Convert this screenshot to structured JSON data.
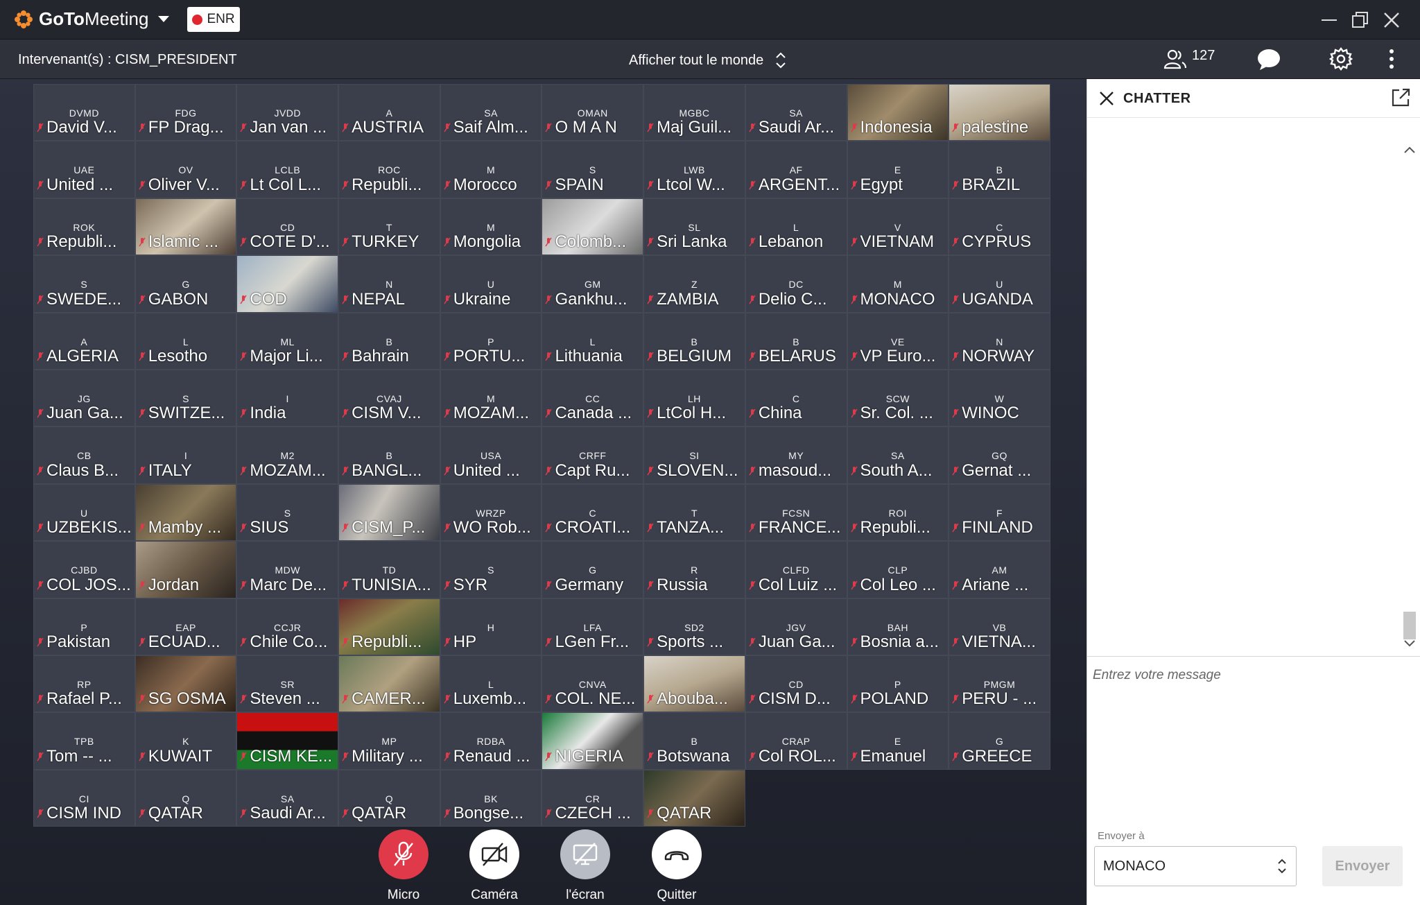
{
  "app": {
    "brand_bold": "GoTo",
    "brand_rest": "Meeting",
    "recording_label": "ENR"
  },
  "subbar": {
    "presenter": "Intervenant(s) : CISM_PRESIDENT",
    "view_mode": "Afficher tout le monde",
    "participant_count": "127"
  },
  "tiles": [
    {
      "initials": "DVMD",
      "name": "David V...",
      "video": ""
    },
    {
      "initials": "FDG",
      "name": "FP Drag...",
      "video": ""
    },
    {
      "initials": "JVDD",
      "name": "Jan van ...",
      "video": ""
    },
    {
      "initials": "A",
      "name": "AUSTRIA",
      "video": ""
    },
    {
      "initials": "SA",
      "name": "Saif Alm...",
      "video": ""
    },
    {
      "initials": "OMAN",
      "name": "O M A N",
      "video": ""
    },
    {
      "initials": "MGBC",
      "name": "Maj Guil...",
      "video": ""
    },
    {
      "initials": "SA",
      "name": "Saudi Ar...",
      "video": ""
    },
    {
      "initials": "",
      "name": "Indonesia",
      "video": "v1"
    },
    {
      "initials": "",
      "name": "palestine",
      "video": "v2"
    },
    {
      "initials": "UAE",
      "name": "United ...",
      "video": ""
    },
    {
      "initials": "OV",
      "name": "Oliver V...",
      "video": ""
    },
    {
      "initials": "LCLB",
      "name": "Lt Col L...",
      "video": ""
    },
    {
      "initials": "ROC",
      "name": "Republi...",
      "video": ""
    },
    {
      "initials": "M",
      "name": "Morocco",
      "video": ""
    },
    {
      "initials": "S",
      "name": "SPAIN",
      "video": ""
    },
    {
      "initials": "LWB",
      "name": "Ltcol W...",
      "video": ""
    },
    {
      "initials": "AF",
      "name": "ARGENT...",
      "video": ""
    },
    {
      "initials": "E",
      "name": "Egypt",
      "video": ""
    },
    {
      "initials": "B",
      "name": "BRAZIL",
      "video": ""
    },
    {
      "initials": "ROK",
      "name": "Republi...",
      "video": ""
    },
    {
      "initials": "",
      "name": "Islamic ...",
      "video": "v4"
    },
    {
      "initials": "CD",
      "name": "COTE D'...",
      "video": ""
    },
    {
      "initials": "T",
      "name": "TURKEY",
      "video": ""
    },
    {
      "initials": "M",
      "name": "Mongolia",
      "video": ""
    },
    {
      "initials": "",
      "name": "Colomb...",
      "video": "v6"
    },
    {
      "initials": "SL",
      "name": "Sri Lanka",
      "video": ""
    },
    {
      "initials": "L",
      "name": "Lebanon",
      "video": ""
    },
    {
      "initials": "V",
      "name": "VIETNAM",
      "video": ""
    },
    {
      "initials": "C",
      "name": "CYPRUS",
      "video": ""
    },
    {
      "initials": "S",
      "name": "SWEDE...",
      "video": ""
    },
    {
      "initials": "G",
      "name": "GABON",
      "video": ""
    },
    {
      "initials": "",
      "name": "COD",
      "video": "v5"
    },
    {
      "initials": "N",
      "name": "NEPAL",
      "video": ""
    },
    {
      "initials": "U",
      "name": "Ukraine",
      "video": ""
    },
    {
      "initials": "GM",
      "name": "Gankhu...",
      "video": ""
    },
    {
      "initials": "Z",
      "name": "ZAMBIA",
      "video": ""
    },
    {
      "initials": "DC",
      "name": "Delio C...",
      "video": ""
    },
    {
      "initials": "M",
      "name": "MONACO",
      "video": ""
    },
    {
      "initials": "U",
      "name": "UGANDA",
      "video": ""
    },
    {
      "initials": "A",
      "name": "ALGERIA",
      "video": ""
    },
    {
      "initials": "L",
      "name": "Lesotho",
      "video": ""
    },
    {
      "initials": "ML",
      "name": "Major Li...",
      "video": ""
    },
    {
      "initials": "B",
      "name": "Bahrain",
      "video": ""
    },
    {
      "initials": "P",
      "name": "PORTU...",
      "video": ""
    },
    {
      "initials": "L",
      "name": "Lithuania",
      "video": ""
    },
    {
      "initials": "B",
      "name": "BELGIUM",
      "video": ""
    },
    {
      "initials": "B",
      "name": "BELARUS",
      "video": ""
    },
    {
      "initials": "VE",
      "name": "VP Euro...",
      "video": ""
    },
    {
      "initials": "N",
      "name": "NORWAY",
      "video": ""
    },
    {
      "initials": "JG",
      "name": "Juan Ga...",
      "video": ""
    },
    {
      "initials": "S",
      "name": "SWITZE...",
      "video": ""
    },
    {
      "initials": "I",
      "name": "India",
      "video": ""
    },
    {
      "initials": "CVAJ",
      "name": "CISM V...",
      "video": ""
    },
    {
      "initials": "M",
      "name": "MOZAM...",
      "video": ""
    },
    {
      "initials": "CC",
      "name": "Canada ...",
      "video": ""
    },
    {
      "initials": "LH",
      "name": "LtCol H...",
      "video": ""
    },
    {
      "initials": "C",
      "name": "China",
      "video": ""
    },
    {
      "initials": "SCW",
      "name": "Sr. Col. ...",
      "video": ""
    },
    {
      "initials": "W",
      "name": "WINOC",
      "video": ""
    },
    {
      "initials": "CB",
      "name": "Claus B...",
      "video": ""
    },
    {
      "initials": "I",
      "name": "ITALY",
      "video": ""
    },
    {
      "initials": "M2",
      "name": "MOZAM...",
      "video": ""
    },
    {
      "initials": "B",
      "name": "BANGL...",
      "video": ""
    },
    {
      "initials": "USA",
      "name": "United ...",
      "video": ""
    },
    {
      "initials": "CRFF",
      "name": "Capt Ru...",
      "video": ""
    },
    {
      "initials": "SI",
      "name": "SLOVEN...",
      "video": ""
    },
    {
      "initials": "MY",
      "name": "masoud...",
      "video": ""
    },
    {
      "initials": "SA",
      "name": "South A...",
      "video": ""
    },
    {
      "initials": "GQ",
      "name": "Gernat ...",
      "video": ""
    },
    {
      "initials": "U",
      "name": "UZBEKIS...",
      "video": ""
    },
    {
      "initials": "",
      "name": "Mamby ...",
      "video": "v12"
    },
    {
      "initials": "S",
      "name": "SIUS",
      "video": ""
    },
    {
      "initials": "",
      "name": "CISM_P...",
      "video": "v3"
    },
    {
      "initials": "WRZP",
      "name": "WO Rob...",
      "video": ""
    },
    {
      "initials": "C",
      "name": "CROATI...",
      "video": ""
    },
    {
      "initials": "T",
      "name": "TANZA...",
      "video": ""
    },
    {
      "initials": "FCSN",
      "name": "FRANCE...",
      "video": ""
    },
    {
      "initials": "ROI",
      "name": "Republi...",
      "video": ""
    },
    {
      "initials": "F",
      "name": "FINLAND",
      "video": ""
    },
    {
      "initials": "CJBD",
      "name": "COL JOS...",
      "video": ""
    },
    {
      "initials": "",
      "name": "Jordan",
      "video": "v9"
    },
    {
      "initials": "MDW",
      "name": "Marc De...",
      "video": ""
    },
    {
      "initials": "TD",
      "name": "TUNISIA...",
      "video": ""
    },
    {
      "initials": "S",
      "name": "SYR",
      "video": ""
    },
    {
      "initials": "G",
      "name": "Germany",
      "video": ""
    },
    {
      "initials": "R",
      "name": "Russia",
      "video": ""
    },
    {
      "initials": "CLFD",
      "name": "Col Luiz ...",
      "video": ""
    },
    {
      "initials": "CLP",
      "name": "Col Leo ...",
      "video": ""
    },
    {
      "initials": "AM",
      "name": "Ariane ...",
      "video": ""
    },
    {
      "initials": "P",
      "name": "Pakistan",
      "video": ""
    },
    {
      "initials": "EAP",
      "name": "ECUAD...",
      "video": ""
    },
    {
      "initials": "CCJR",
      "name": "Chile Co...",
      "video": ""
    },
    {
      "initials": "",
      "name": "Republi...",
      "video": "v7"
    },
    {
      "initials": "H",
      "name": "HP",
      "video": ""
    },
    {
      "initials": "LFA",
      "name": "LGen Fr...",
      "video": ""
    },
    {
      "initials": "SD2",
      "name": "Sports ...",
      "video": ""
    },
    {
      "initials": "JGV",
      "name": "Juan Ga...",
      "video": ""
    },
    {
      "initials": "BAH",
      "name": "Bosnia a...",
      "video": ""
    },
    {
      "initials": "VB",
      "name": "VIETNA...",
      "video": ""
    },
    {
      "initials": "RP",
      "name": "Rafael P...",
      "video": ""
    },
    {
      "initials": "",
      "name": "SG OSMA",
      "video": "v8"
    },
    {
      "initials": "SR",
      "name": "Steven ...",
      "video": ""
    },
    {
      "initials": "",
      "name": "CAMER...",
      "video": "v13"
    },
    {
      "initials": "L",
      "name": "Luxemb...",
      "video": ""
    },
    {
      "initials": "CNVA",
      "name": "COL. NE...",
      "video": ""
    },
    {
      "initials": "",
      "name": "Abouba...",
      "video": "v2"
    },
    {
      "initials": "CD",
      "name": "CISM D...",
      "video": ""
    },
    {
      "initials": "P",
      "name": "POLAND",
      "video": ""
    },
    {
      "initials": "PMGM",
      "name": "PERU - ...",
      "video": ""
    },
    {
      "initials": "TPB",
      "name": "Tom -- ...",
      "video": ""
    },
    {
      "initials": "K",
      "name": "KUWAIT",
      "video": ""
    },
    {
      "initials": "",
      "name": "CISM KE...",
      "video": "v10"
    },
    {
      "initials": "MP",
      "name": "Military ...",
      "video": ""
    },
    {
      "initials": "RDBA",
      "name": "Renaud ...",
      "video": ""
    },
    {
      "initials": "",
      "name": "NIGERIA",
      "video": "v11"
    },
    {
      "initials": "B",
      "name": "Botswana",
      "video": ""
    },
    {
      "initials": "CRAP",
      "name": "Col ROL...",
      "video": ""
    },
    {
      "initials": "E",
      "name": "Emanuel",
      "video": ""
    },
    {
      "initials": "G",
      "name": "GREECE",
      "video": ""
    },
    {
      "initials": "CI",
      "name": "CISM IND",
      "video": ""
    },
    {
      "initials": "Q",
      "name": "QATAR",
      "video": ""
    },
    {
      "initials": "SA",
      "name": "Saudi Ar...",
      "video": ""
    },
    {
      "initials": "Q",
      "name": "QATAR",
      "video": ""
    },
    {
      "initials": "BK",
      "name": "Bongse...",
      "video": ""
    },
    {
      "initials": "CR",
      "name": "CZECH ...",
      "video": ""
    },
    {
      "initials": "",
      "name": "QATAR",
      "video": "v14"
    }
  ],
  "controls": {
    "micro": "Micro",
    "camera": "Caméra",
    "screen": "l'écran",
    "quit": "Quitter"
  },
  "chat": {
    "title": "CHATTER",
    "message_placeholder": "Entrez votre message",
    "send_to_label": "Envoyer à",
    "recipient": "MONACO",
    "send_button": "Envoyer"
  },
  "colors": {
    "accent_logo": "#f68d2e",
    "mic_off": "#e03a4a",
    "record": "#e0262e"
  }
}
